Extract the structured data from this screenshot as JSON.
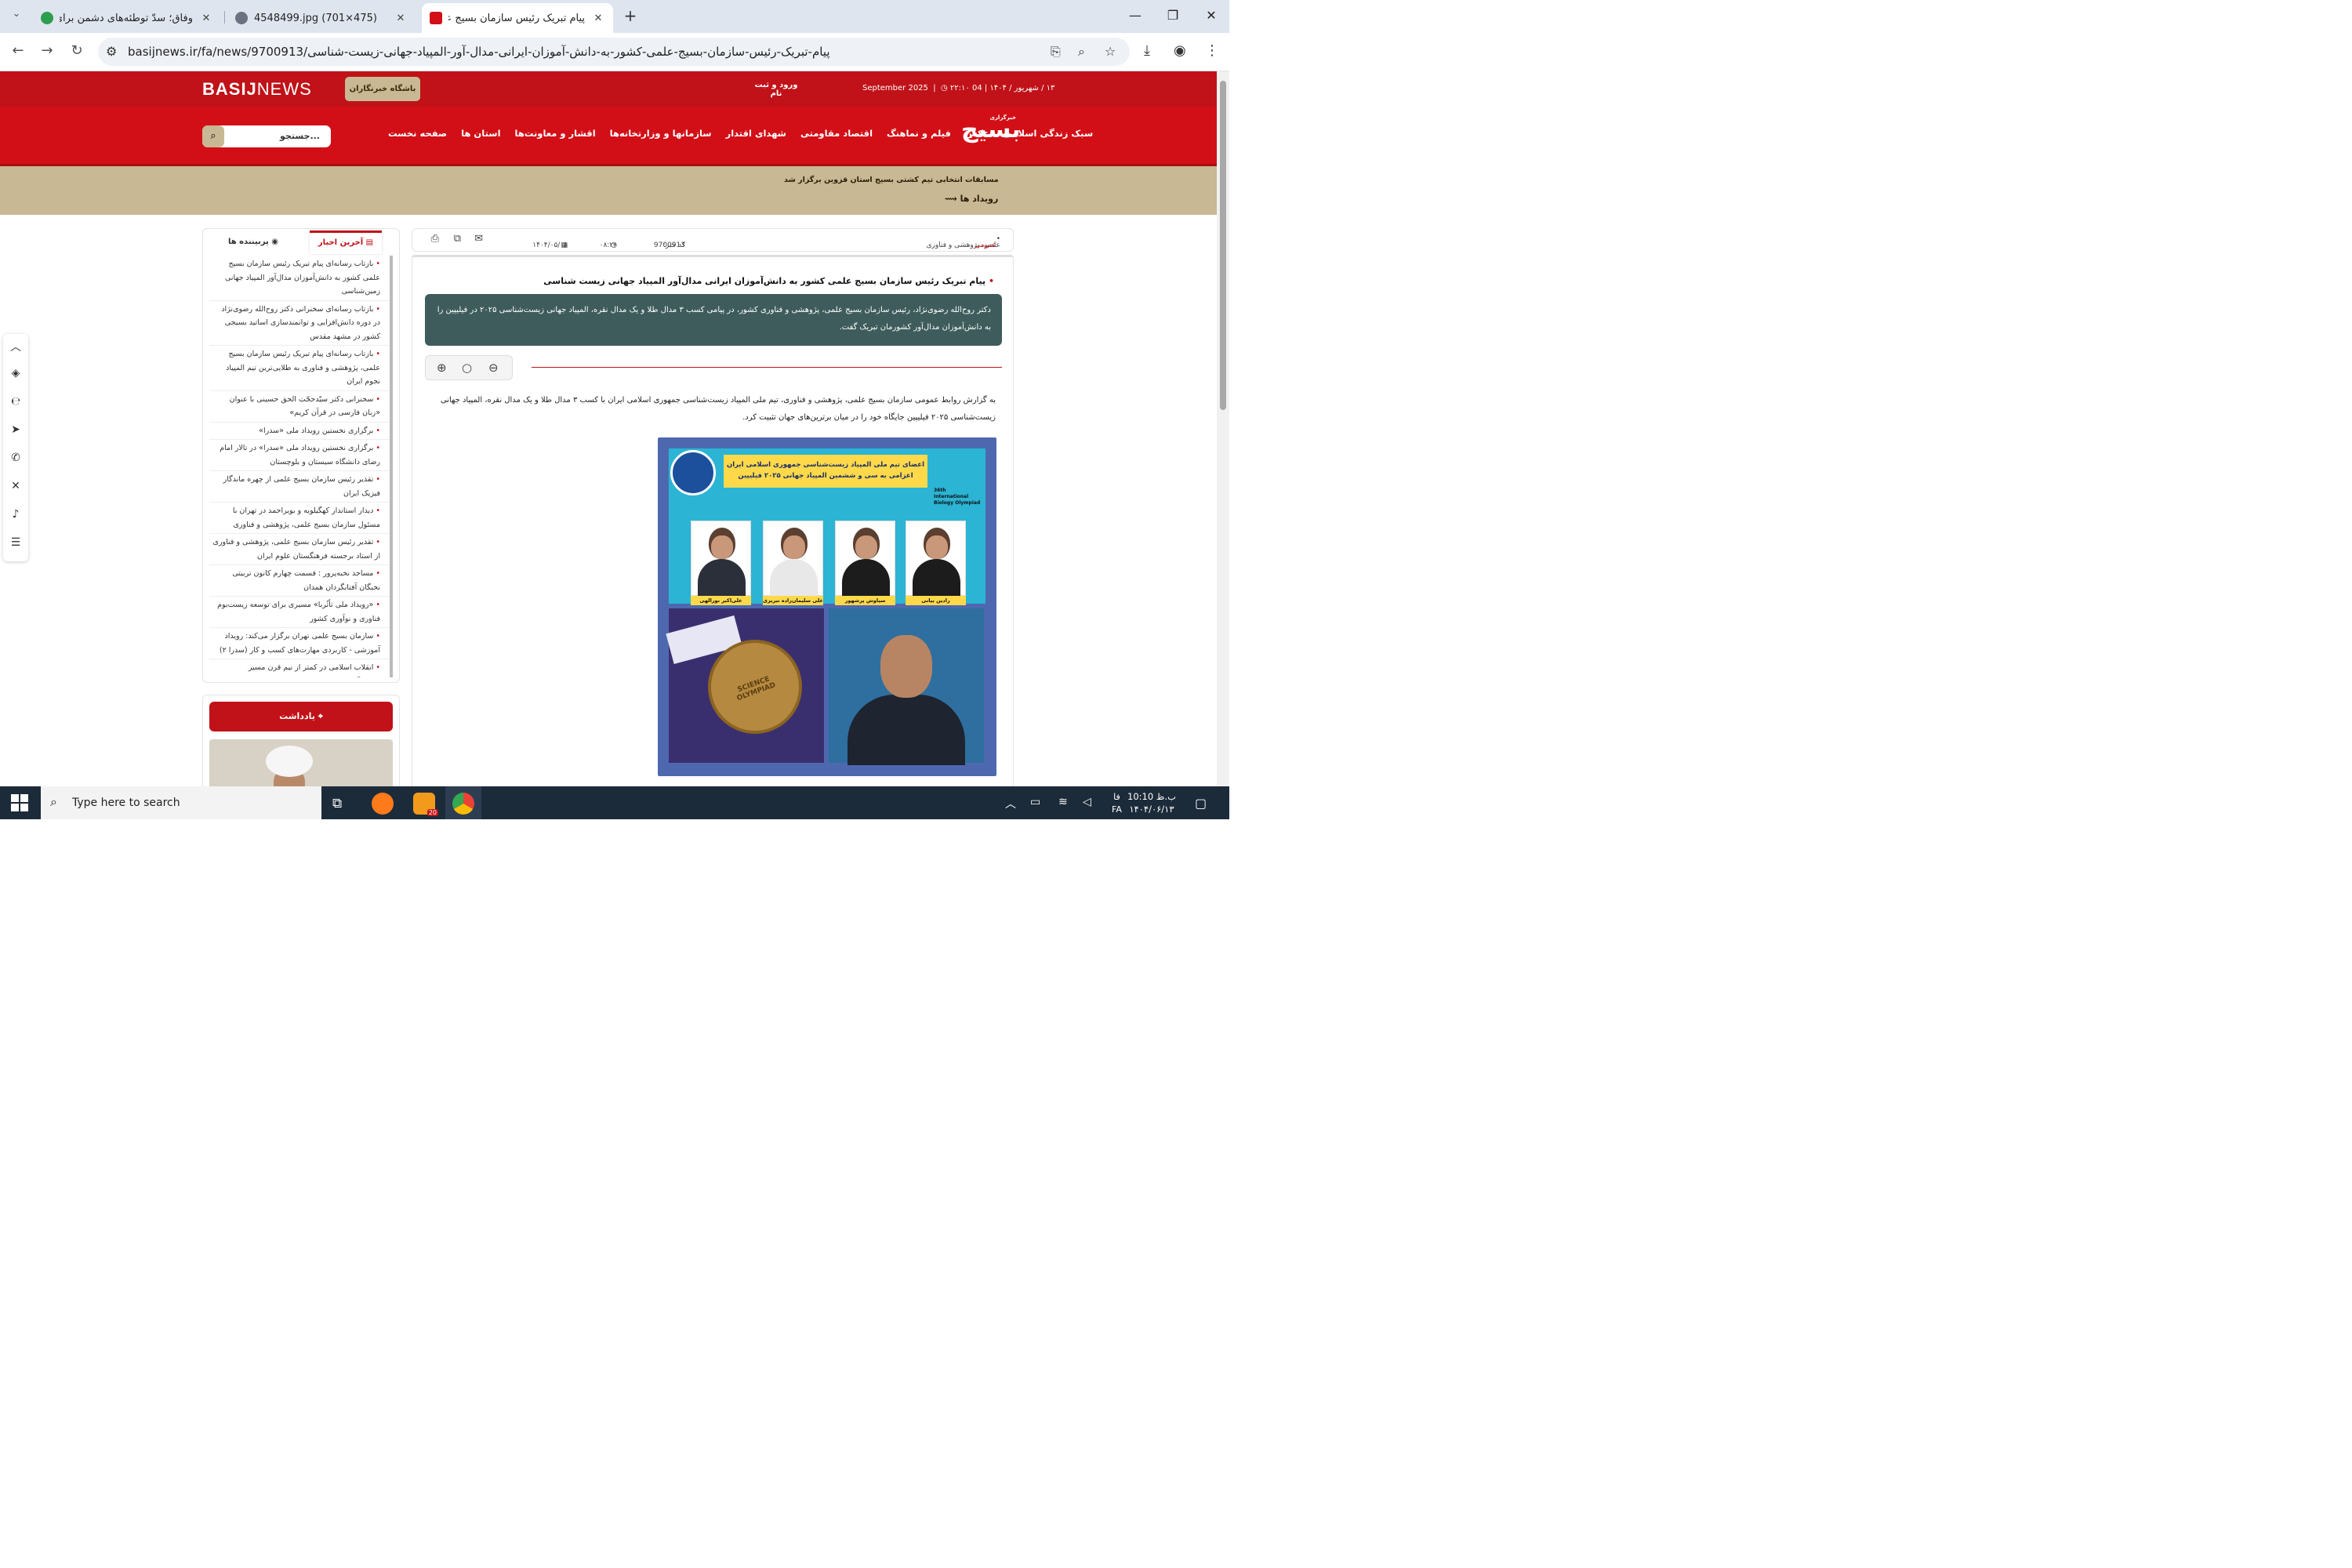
{
  "browser": {
    "tabs": [
      {
        "title": "وفاق؛ سدّ توطئه‌های دشمن برای",
        "active": false
      },
      {
        "title": "4548499.jpg (701×475)",
        "active": false
      },
      {
        "title": "پیام تبریک رئیس سازمان بسیج علم",
        "active": true
      }
    ],
    "new_tab": "+",
    "url": "basijnews.ir/fa/news/9700913/پیام-تبریک-رئیس-سازمان-بسیج-علمی-کشور-به-دانش-آموزان-ایرانی-مدال-آور-المپیاد-جهانی-زیست-شناسی"
  },
  "site": {
    "logo_en_bold": "BASIJ",
    "logo_en_light": "NEWS",
    "club_button": "باشگاه خبرنگاران",
    "login": "ورود و ثبت نام",
    "time": "۲۲:۱۰",
    "date": "۱۳ / شهریور / ۱۴۰۴ | 04 September 2025",
    "brand_small": "خبرگزاری",
    "brand": "بسیج",
    "search_placeholder": "جستجو...",
    "menu": [
      "صفحه نخست",
      "استان ها",
      "اقشار و معاونت‌ها",
      "سازمانها و وزارتخانه‌ها",
      "شهدای اقتدار",
      "اقتصاد مقاومتی",
      "فیلم و نماهنگ",
      "عکس",
      "سبک زندگی اسلامی"
    ],
    "ticker": "مسابقات انتخابی تیم کشتی بسیج استان قزوین برگزار شد",
    "events_label": "رویداد ها"
  },
  "meta": {
    "category": "علمی، پژوهشی و فناوری",
    "subcategory": "عمومی",
    "news_code_label": "کد خبر:",
    "news_code": "9700913",
    "time": "۰۸:۲۶",
    "date": "۱۴۰۴/۰۵/۰۸"
  },
  "article": {
    "headline": "پیام تبریک رئیس سازمان بسیج علمی کشور به دانش‌آموزان ایرانی مدال‌آور المپیاد جهانی زیست شناسی",
    "lead": "دکتر روح‌الله رضوی‌نژاد، رئیس سازمان بسیج علمی، پژوهشی و فناوری کشور، در پیامی کسب ۳ مدال طلا و یک مدال نقره، المپیاد جهانی زیست‌شناسی ۲۰۲۵ در فیلیپین را به دانش‌آموزان مدال‌آور کشورمان تبریک گفت.",
    "body": "به گزارش روابط عمومی سازمان بسیج علمی، پژوهشی و فناوری، تیم ملی المپیاد زیست‌شناسی جمهوری اسلامی ایران با کسب ۳ مدال طلا و یک مدال نقره، المپیاد جهانی زیست‌شناسی ۲۰۲۵ فیلیپین جایگاه خود را در میان برترین‌های جهان تثبیت کرد.",
    "zoom": {
      "in": "⊕",
      "reset": "○",
      "out": "⊖"
    },
    "image": {
      "banner_line1": "اعضای تیم ملی المپیاد زیست‌شناسی جمهوری اسلامی ایران",
      "banner_line2": "اعزامی به سی و ششمین المپیاد جهانی ۲۰۲۵ فیلیپین",
      "intl_label": "36th International Biology Olympiad",
      "students": [
        "علی‌اکبر نورالهی",
        "علی سلیمان‌زاده تبریزی",
        "سیاوش پرشهور",
        "رادین بیانی"
      ],
      "medal_text": "SCIENCE OLYMPIAD"
    }
  },
  "sidebar": {
    "tab_latest": "آخرین اخبار",
    "tab_popular": "پربیننده ها",
    "news": [
      "بازتاب رسانه‌ای پیام تبریک رئیس سازمان بسیج علمی کشور به دانش‌آموزان مدال‌آور المپیاد جهانی زمین‌شناسی",
      "بازتاب رسانه‌ای سخنرانی دکتر روح‌الله رضوی‌نژاد در دوره دانش‌افزایی و توانمندسازی اساتید بسیجی کشور در مشهد مقدس",
      "بازتاب رسانه‌ای پیام تبریک رئیس سازمان بسیج علمی، پژوهشی و فناوری به طلایی‌ترین تیم المپیاد نجوم ایران",
      "سخنرانی دکتر سیّدحجّت الحق حسینی با عنوان «زبان فارسی در قرآن کریم»",
      "برگزاری نخستین رویداد ملی «سدرا»",
      "برگزاری نخستین رویداد ملی «سدرا» در تالار امام رضای دانشگاه سیستان و بلوچستان",
      "تقدیر رئیس سازمان بسیج علمی از چهره ماندگار فیزیک ایران",
      "دیدار استاندار کهگیلویه و بویراحمد در تهران با مسئول سازمان بسیج علمی، پژوهشی و فناوری",
      "تقدیر رئیس سازمان بسیج علمی، پژوهشی و فناوری از استاد برجسته فرهنگستان علوم ایران",
      "مساجد نخبه‌پرور : قسمت چهارم کانون تربیتی نخبگان آفتابگردان همدان",
      "«رویداد ملی تأثُربا» مسیری برای توسعه زیست‌بوم فناوری و نوآوری کشور",
      "سازمان بسیج علمی تهران برگزار می‌کند: رویداد آموزشی - کاربردی مهارت‌های کسب و کار (سدرا ۲)",
      "انقلاب اسلامی در کمتر از نیم قرن مسیر معجزه‌آسایی را پیموده است"
    ],
    "notes_title": "یادداشت"
  },
  "taskbar": {
    "search_placeholder": "Type here to search",
    "badge": "20",
    "lang": "فا",
    "lang2": "FA",
    "time": "10:10 ب.ظ",
    "date": "۱۴۰۴/۰۶/۱۳"
  },
  "colors": {
    "brand_red": "#d20f17",
    "gold": "#c8b893",
    "lead_bg": "#3e5c5b"
  }
}
